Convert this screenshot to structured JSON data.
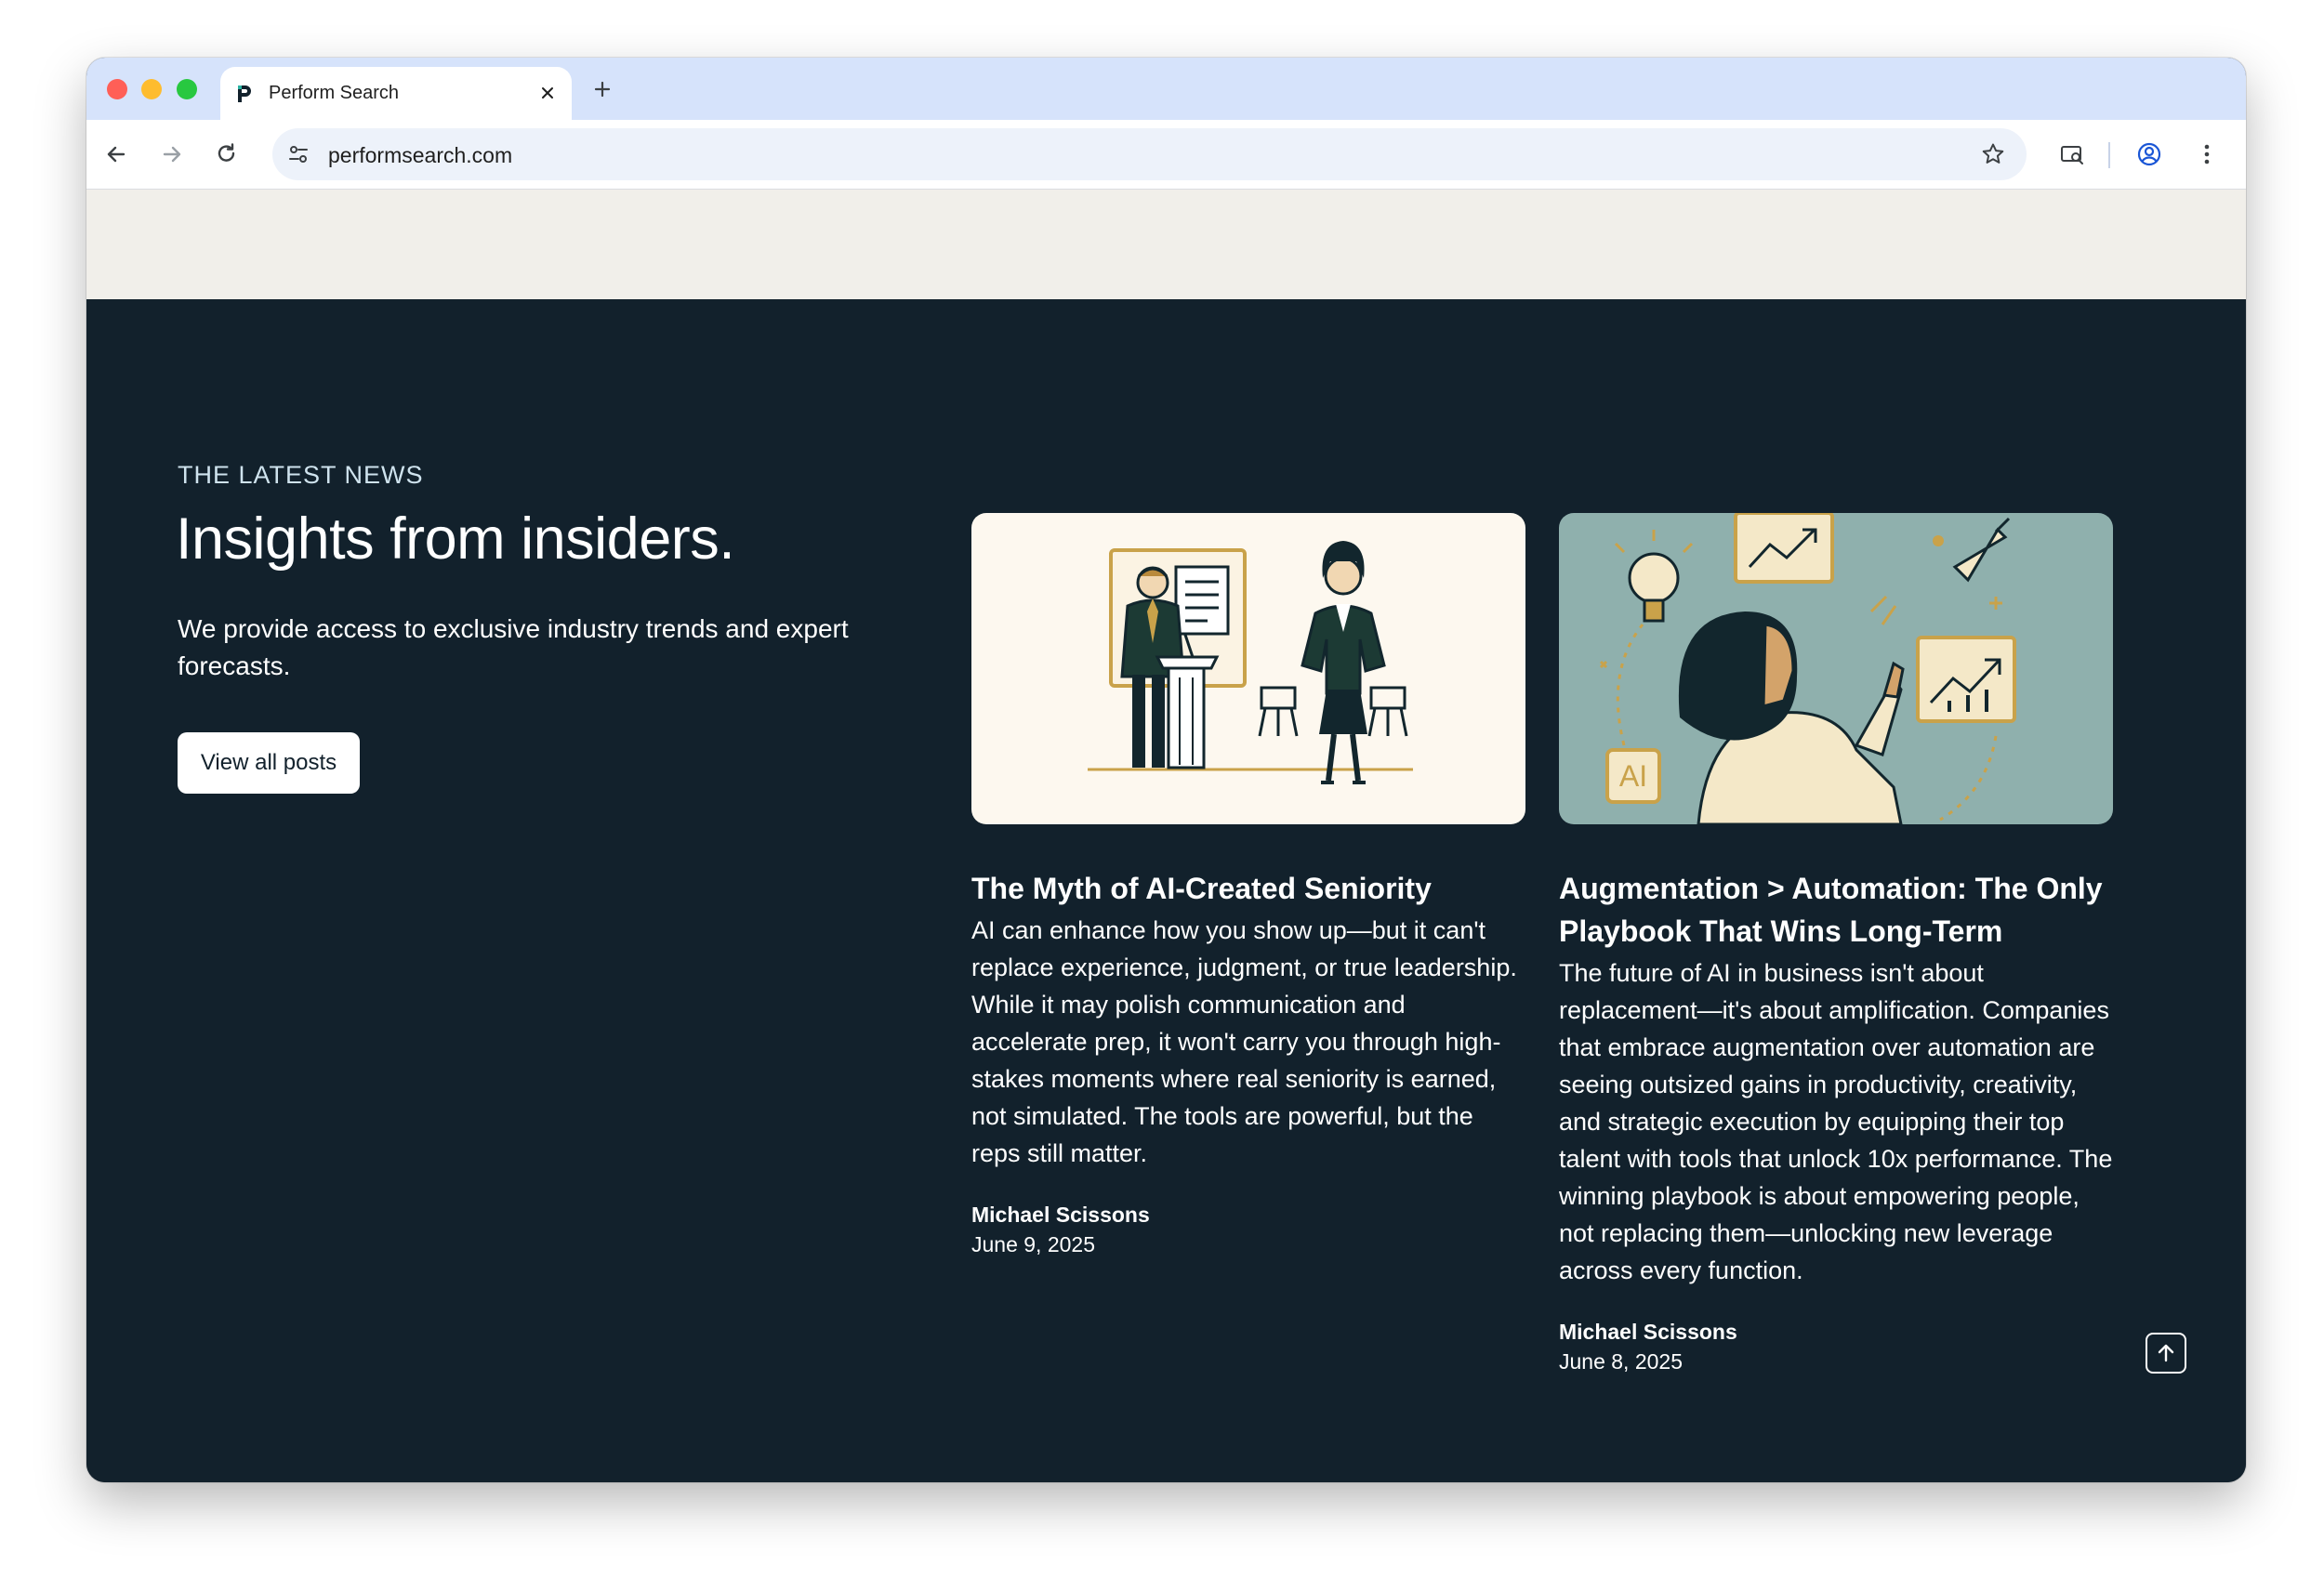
{
  "browser": {
    "tab_title": "Perform Search",
    "url": "performsearch.com"
  },
  "hero": {
    "eyebrow": "THE LATEST NEWS",
    "headline": "Insights from insiders.",
    "lead": "We provide access to exclusive industry trends and expert forecasts.",
    "button_label": "View all posts"
  },
  "posts": [
    {
      "title": "The Myth of AI-Created Seniority",
      "excerpt": "AI can enhance how you show up—but it can't replace experience, judgment, or true leadership. While it may polish communication and accelerate prep, it won't carry you through high-stakes moments where real seniority is earned, not simulated. The tools are powerful, but the reps still matter.",
      "author": "Michael Scissons",
      "date": "June 9, 2025"
    },
    {
      "title": "Augmentation > Automation: The Only Playbook That Wins Long-Term",
      "excerpt": "The future of AI in business isn't about replacement—it's about amplification. Companies that embrace augmentation over automation are seeing outsized gains in productivity, creativity, and strategic execution by equipping their top talent with tools that unlock 10x performance. The winning playbook is about empowering people, not replacing them—unlocking new leverage across every function.",
      "author": "Michael Scissons",
      "date": "June 8, 2025",
      "image_badge": "AI"
    }
  ],
  "colors": {
    "page_bg": "#12212c",
    "band_bg": "#f1efea",
    "accent_gold": "#c9a24a",
    "card2_bg": "#8fb0ad",
    "card1_bg": "#fdf8ef"
  }
}
